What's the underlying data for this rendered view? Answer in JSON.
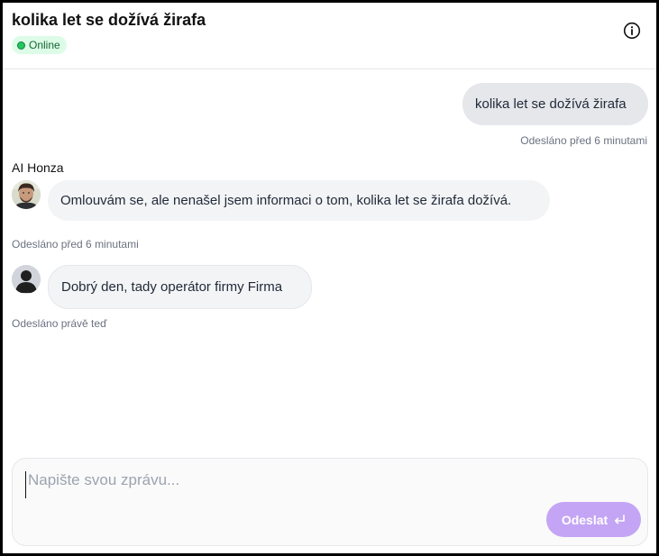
{
  "header": {
    "title": "kolika let se dožívá žirafa",
    "status": "Online",
    "info_icon": "info-circle-icon"
  },
  "messages": [
    {
      "role": "user",
      "text": "kolika let se dožívá žirafa",
      "time": "Odesláno před 6 minutami"
    },
    {
      "role": "ai",
      "sender": "AI Honza",
      "avatar_icon": "ai-avatar-photo",
      "text": "Omlouvám se, ale nenašel jsem informaci o tom, kolika let se žirafa dožívá.",
      "time": "Odesláno před 6 minutami"
    },
    {
      "role": "operator",
      "avatar_icon": "user-silhouette-icon",
      "text": "Dobrý den, tady operátor firmy Firma",
      "time": "Odesláno právě teď"
    }
  ],
  "composer": {
    "placeholder": "Napište svou zprávu...",
    "value": "",
    "send_label": "Odeslat",
    "send_icon": "enter-return-icon"
  },
  "colors": {
    "status_bg": "#dcfce7",
    "status_dot": "#22c55e",
    "send_button": "#c4a5f5",
    "user_bubble": "#e5e7eb",
    "other_bubble": "#f3f4f6"
  }
}
